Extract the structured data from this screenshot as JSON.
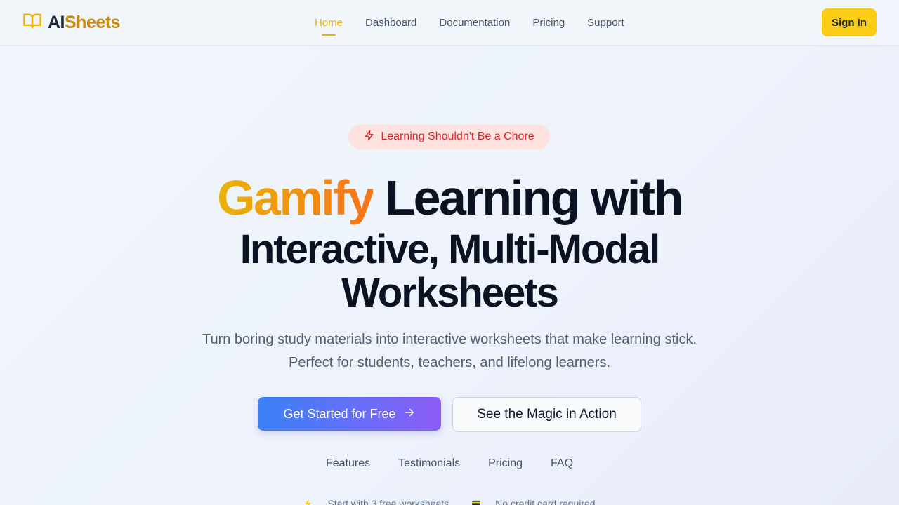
{
  "brand": {
    "part1": "AI",
    "part2": "Sheets",
    "icon": "book-open-icon"
  },
  "nav": {
    "items": [
      {
        "label": "Home",
        "active": true
      },
      {
        "label": "Dashboard"
      },
      {
        "label": "Documentation"
      },
      {
        "label": "Pricing"
      },
      {
        "label": "Support"
      }
    ],
    "sign_in": "Sign In"
  },
  "hero": {
    "badge": {
      "icon": "lightning-bolt-icon",
      "text": "Learning Shouldn't Be a Chore"
    },
    "headline": {
      "highlight": "Gamify",
      "line1_rest": " Learning with",
      "line2": "Interactive, Multi-Modal",
      "line3": "Worksheets"
    },
    "subtitle": "Turn boring study materials into interactive worksheets that make learning stick. Perfect for students, teachers, and lifelong learners.",
    "cta_primary": "Get Started for Free",
    "cta_secondary": "See the Magic in Action"
  },
  "section_links": [
    "Features",
    "Testimonials",
    "Pricing",
    "FAQ"
  ],
  "perks": [
    {
      "icon": "lightning-icon",
      "text": "Start with 3 free worksheets"
    },
    {
      "icon": "credit-card-icon",
      "text": "No credit card required"
    }
  ],
  "colors": {
    "accent": "#facc15",
    "brand_gold": "#c98a14",
    "badge_bg": "#fde2e0",
    "badge_text": "#dc2626",
    "cta_gradient_start": "#3b82f6",
    "cta_gradient_end": "#8b5cf6"
  }
}
